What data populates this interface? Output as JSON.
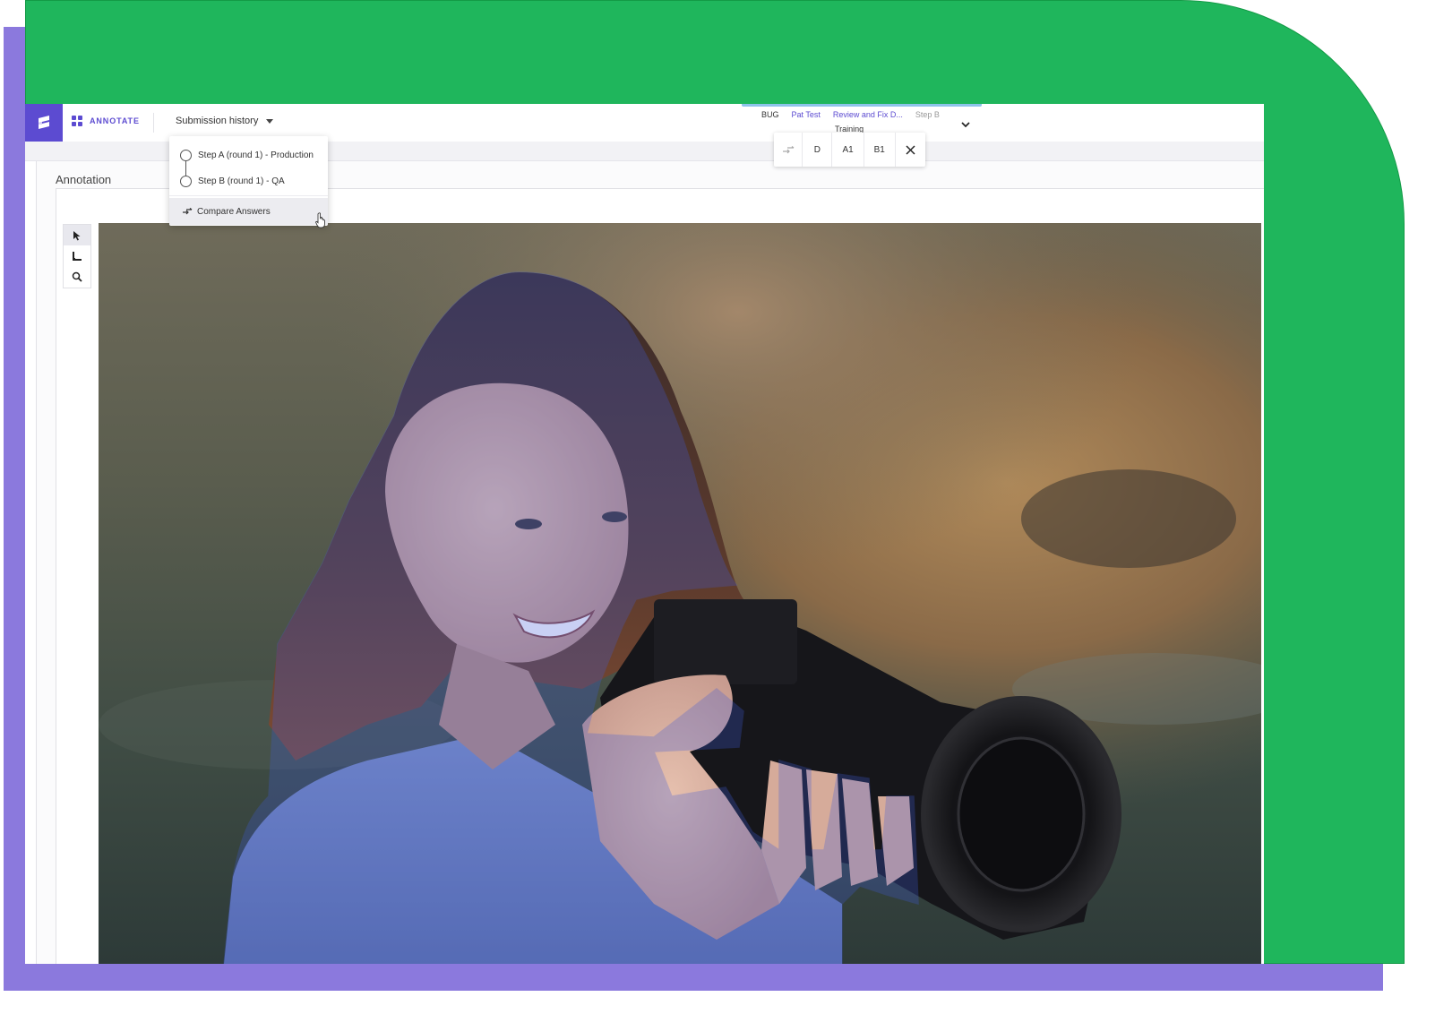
{
  "app": {
    "logo_letter": "S",
    "nav_label": "ANNOTATE",
    "submission_history_label": "Submission history",
    "accent_color": "#5c4bd1"
  },
  "breadcrumbs": {
    "items": [
      "BUG",
      "Pat Test",
      "Review and Fix D...",
      "Step B"
    ],
    "sub_label": "Training"
  },
  "submission_dropdown": {
    "steps": [
      {
        "label": "Step A (round 1) - Production"
      },
      {
        "label": "Step B (round 1) - QA"
      }
    ],
    "compare_label": "Compare Answers"
  },
  "compare_bar": {
    "buttons": [
      "D",
      "A1",
      "B1"
    ],
    "close_icon": "close-icon",
    "compare_icon": "compare-arrows-icon"
  },
  "panel": {
    "title": "Annotation"
  },
  "tools": [
    {
      "name": "select-arrow-icon"
    },
    {
      "name": "bounding-box-icon"
    },
    {
      "name": "zoom-icon"
    }
  ],
  "backdrop_colors": {
    "green": "#1fb65c",
    "purple": "#8b79dd"
  }
}
